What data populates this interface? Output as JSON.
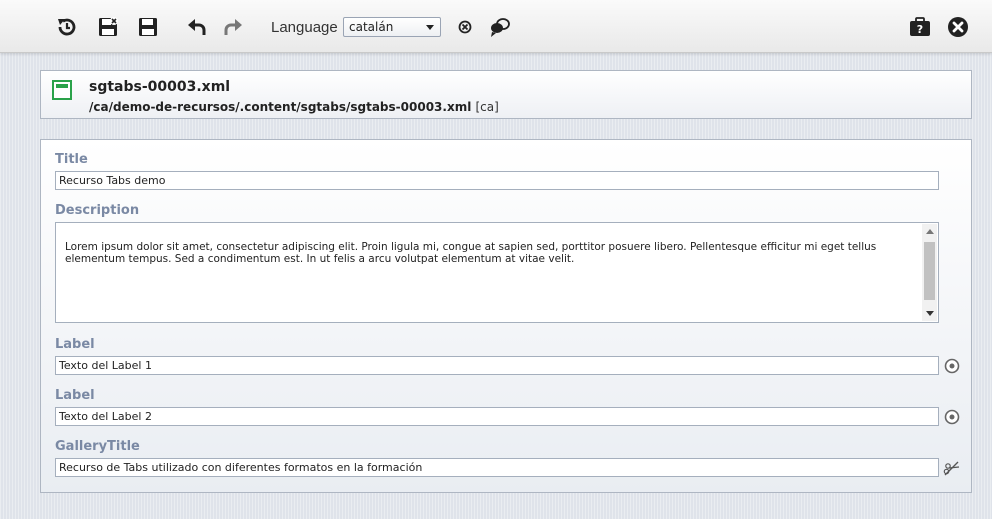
{
  "toolbar": {
    "language_label": "Language",
    "language_value": "catalán",
    "icons": [
      "history-icon",
      "save-and-exit-icon",
      "save-icon",
      "undo-icon",
      "redo-icon",
      "remove-locale-icon",
      "compare-locale-icon",
      "help-icon",
      "close-icon"
    ]
  },
  "header": {
    "title": "sgtabs-00003.xml",
    "path": "/ca/demo-de-recursos/.content/sgtabs/sgtabs-00003.xml",
    "locale_tag": "[ca]"
  },
  "form": {
    "fields": [
      {
        "label": "Title",
        "value": "Recurso Tabs demo"
      },
      {
        "label": "Description",
        "value": "Lorem ipsum dolor sit amet, consectetur adipiscing elit. Proin ligula mi, congue at sapien sed, porttitor posuere libero. Pellentesque efficitur mi eget tellus elementum tempus. Sed a condimentum est. In ut felis a arcu volutpat elementum at vitae velit."
      },
      {
        "label": "Label",
        "value": "Texto del Label 1"
      },
      {
        "label": "Label",
        "value": "Texto del Label 2"
      },
      {
        "label": "GalleryTitle",
        "value": "Recurso de Tabs utilizado con diferentes formatos en la formación"
      }
    ]
  },
  "colors": {
    "field_label": "#7a89a4",
    "file_icon": "#2aa24a",
    "page_background": "#dfe3ea"
  }
}
